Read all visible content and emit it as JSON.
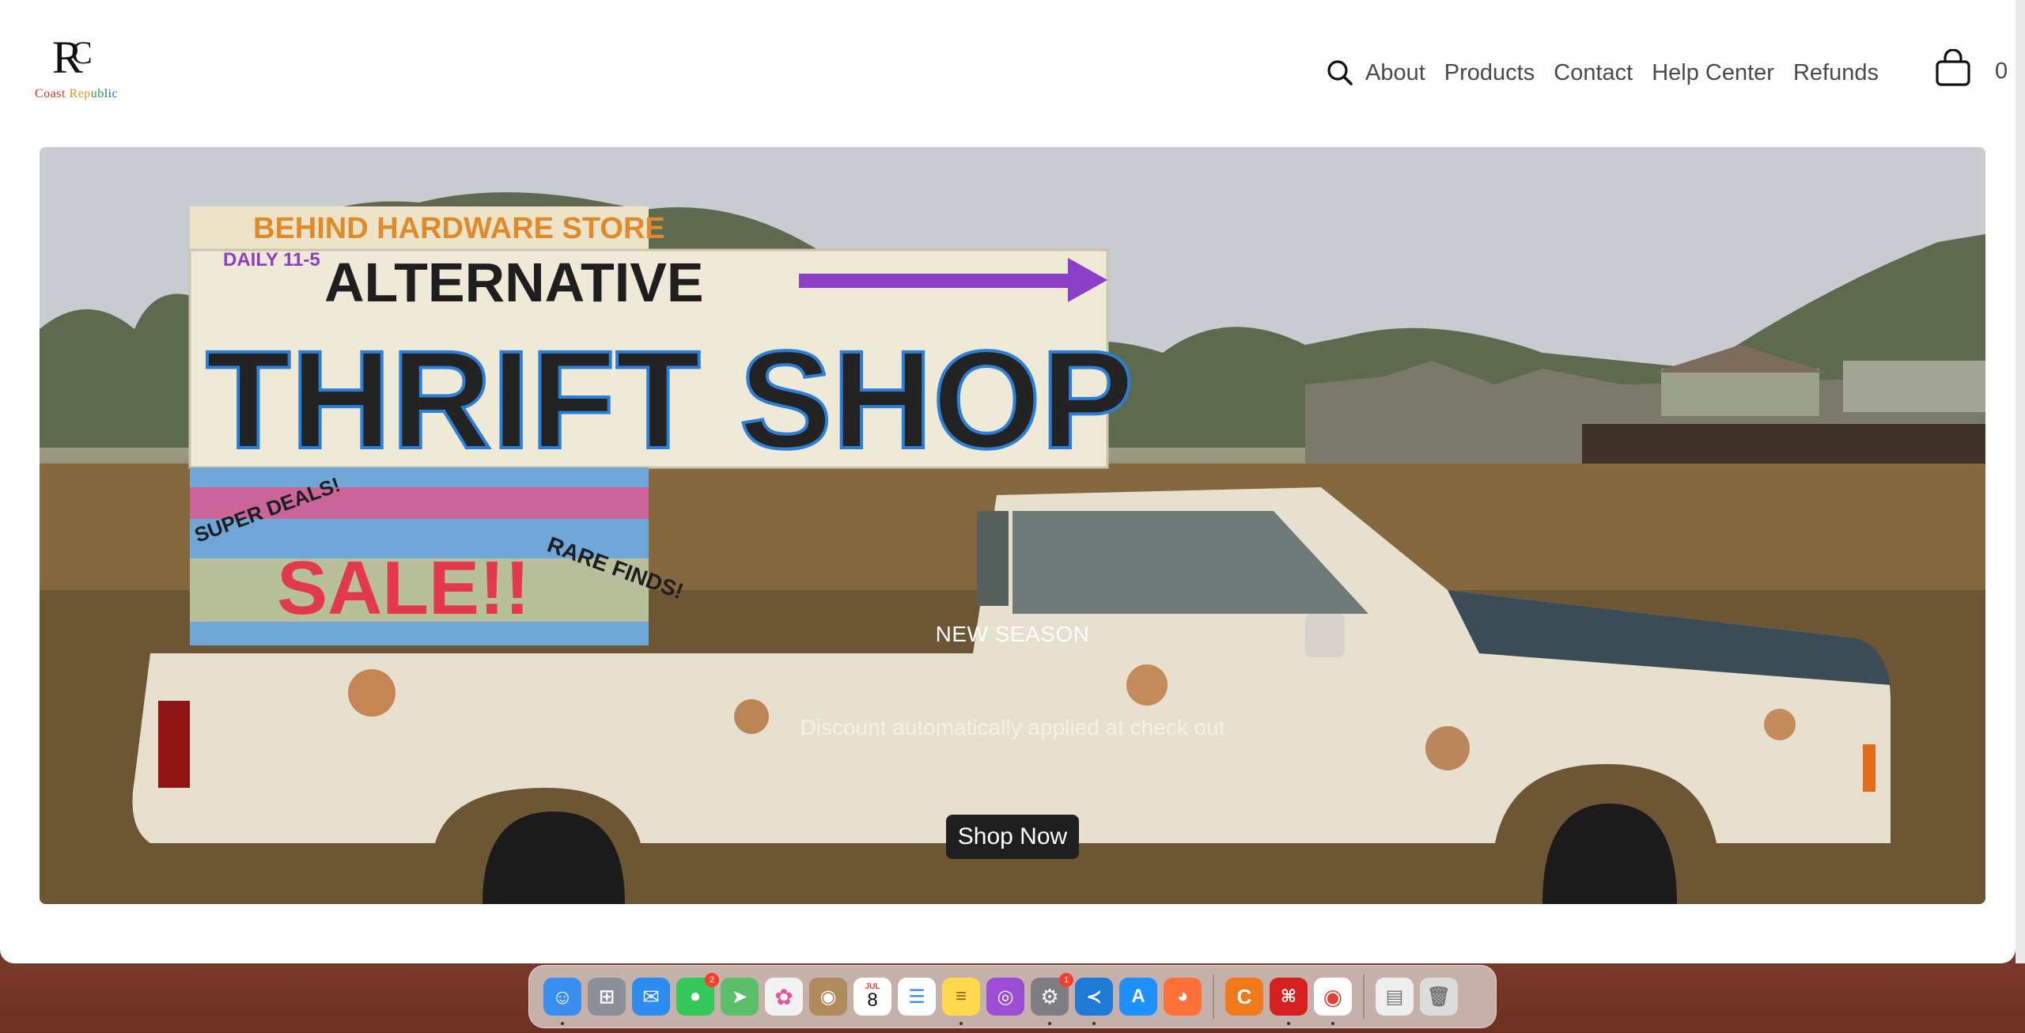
{
  "brand": {
    "logo_initials": "RC",
    "logo_words": [
      "Coast",
      "Rep",
      "ub",
      "lic"
    ]
  },
  "nav": {
    "items": [
      "About",
      "Products",
      "Contact",
      "Help Center",
      "Refunds"
    ],
    "cart_count": "0"
  },
  "hero": {
    "title": "NEW SEASON",
    "subtitle": "Discount automatically applied at check out",
    "button_label": "Shop Now",
    "sign_top": "BEHIND HARDWARE STORE",
    "sign_hours": "DAILY 11-5",
    "sign_alt": "ALTERNATIVE",
    "sign_main": "THRIFT SHOP",
    "sign_sale": "SALE!!",
    "sign_deals": "SUPER DEALS!",
    "sign_finds": "RARE FINDS!"
  },
  "dock": {
    "apps": [
      {
        "name": "Finder",
        "icon": "finder-icon",
        "color": "#3a8ef0",
        "running": true
      },
      {
        "name": "Launchpad",
        "icon": "launchpad-icon",
        "color": "#8a8f99"
      },
      {
        "name": "Mail",
        "icon": "mail-icon",
        "color": "#2d8cf0"
      },
      {
        "name": "Messages",
        "icon": "messages-icon",
        "color": "#34c759",
        "badge": "2"
      },
      {
        "name": "Maps",
        "icon": "maps-icon",
        "color": "#5bbf6a"
      },
      {
        "name": "Photos",
        "icon": "photos-icon",
        "color": "#f2f2f2"
      },
      {
        "name": "Contacts",
        "icon": "contacts-icon",
        "color": "#b08a5a"
      },
      {
        "name": "Calendar",
        "icon": "calendar-icon",
        "color": "#ffffff",
        "month": "JUL",
        "day": "8"
      },
      {
        "name": "Reminders",
        "icon": "reminders-icon",
        "color": "#ffffff"
      },
      {
        "name": "Notes",
        "icon": "notes-icon",
        "color": "#ffd84d",
        "running": true
      },
      {
        "name": "Podcasts",
        "icon": "podcasts-icon",
        "color": "#9b4dd6"
      },
      {
        "name": "System Settings",
        "icon": "settings-icon",
        "color": "#7d7d82",
        "badge": "1",
        "running": true
      },
      {
        "name": "VS Code",
        "icon": "vscode-icon",
        "color": "#1f7ad6",
        "running": true
      },
      {
        "name": "App Store",
        "icon": "appstore-icon",
        "color": "#1e90ff"
      },
      {
        "name": "Firefox",
        "icon": "firefox-icon",
        "color": "#ff7139"
      },
      {
        "name": "Cashew",
        "icon": "c-app-icon",
        "color": "#f07a1a"
      },
      {
        "name": "Acrobat",
        "icon": "acrobat-icon",
        "color": "#d61f1f",
        "running": true
      },
      {
        "name": "Chrome",
        "icon": "chrome-icon",
        "color": "#ffffff",
        "running": true
      },
      {
        "name": "Document",
        "icon": "document-icon",
        "color": "#eeeeee"
      },
      {
        "name": "Trash",
        "icon": "trash-icon",
        "color": "#dcdcdc"
      }
    ]
  }
}
